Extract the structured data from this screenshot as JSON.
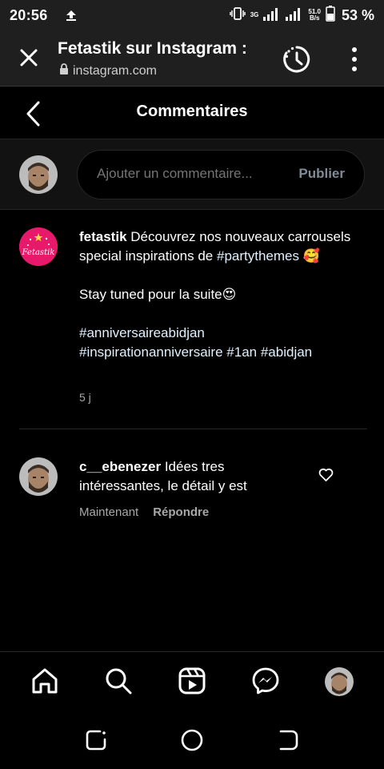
{
  "status_bar": {
    "time": "20:56",
    "network_type": "3G",
    "speed_value": "51.0",
    "speed_unit": "B/s",
    "battery_percent": "53 %"
  },
  "browser": {
    "title": "Fetastik sur Instagram :",
    "url": "instagram.com"
  },
  "header": {
    "title": "Commentaires"
  },
  "composer": {
    "placeholder": "Ajouter un commentaire...",
    "publish_label": "Publier"
  },
  "caption": {
    "logo_text": "Fetastik",
    "username": "fetastik",
    "line1": "Découvrez nos nouveaux carrousels special inspirations de",
    "hashtag1": "#partythemes",
    "emoji1": "🥰",
    "line2": "Stay tuned pour la suite",
    "emoji2": "😍",
    "hashtag2": "#anniversaireabidjan",
    "hashtag3": "#inspirationanniversaire",
    "hashtag4": "#1an",
    "hashtag5": "#abidjan",
    "time_ago": "5 j"
  },
  "comment": {
    "username": "c__ebenezer",
    "text": "Idées tres intéressantes, le détail y est",
    "time": "Maintenant",
    "reply_label": "Répondre"
  },
  "colors": {
    "brand_pink": "#e8196a",
    "publish_disabled": "#7f8b98",
    "secondary_text": "#a8a8a8"
  }
}
